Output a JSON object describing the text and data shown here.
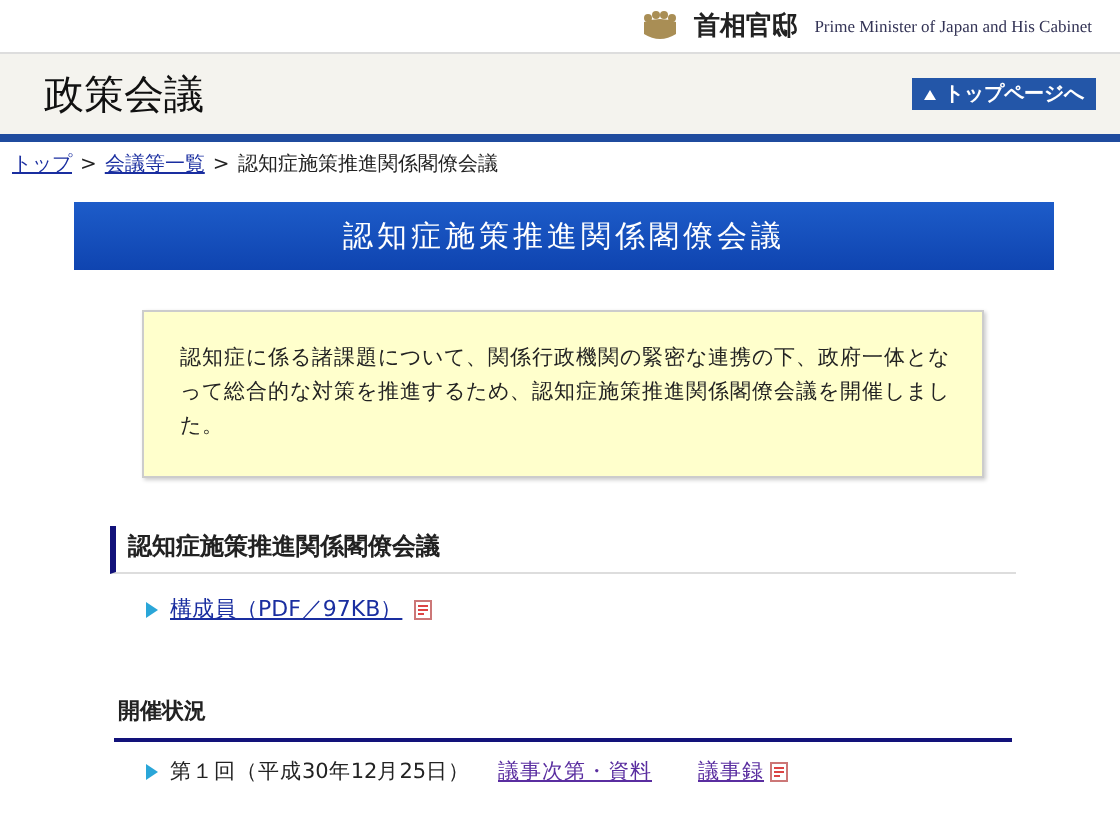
{
  "header": {
    "logo_text": "首相官邸",
    "logo_subtitle": "Prime Minister of Japan and His Cabinet"
  },
  "title_bar": {
    "title": "政策会議",
    "top_button": "トップページへ"
  },
  "breadcrumb_separator": ">",
  "breadcrumb": [
    {
      "label": "トップ",
      "kind": "link"
    },
    {
      "label": "会議等一覧",
      "kind": "link"
    },
    {
      "label": "認知症施策推進関係閣僚会議",
      "kind": "current"
    }
  ],
  "banner": {
    "title": "認知症施策推進関係閣僚会議"
  },
  "intro": "認知症に係る諸課題について、関係行政機関の緊密な連携の下、政府一体となって総合的な対策を推進するため、認知症施策推進関係閣僚会議を開催しました。",
  "section": {
    "heading": "認知症施策推進関係閣僚会議",
    "links": [
      {
        "label": "構成員（PDF／97KB）",
        "pdf": true
      }
    ]
  },
  "meetings": {
    "heading": "開催状況",
    "rows": [
      {
        "label": "第１回（平成30年12月25日）",
        "agenda": "議事次第・資料",
        "minutes": "議事録"
      }
    ]
  }
}
